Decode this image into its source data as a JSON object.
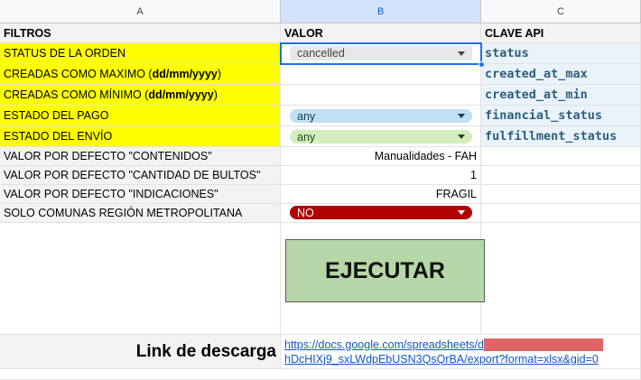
{
  "columns": [
    "A",
    "B",
    "C"
  ],
  "headers": {
    "a": "FILTROS",
    "b": "VALOR",
    "c": "CLAVE API"
  },
  "rows": [
    {
      "label": "STATUS DE LA ORDEN",
      "value": "cancelled",
      "api": "status"
    },
    {
      "label_pre": "CREADAS COMO MAXIMO (",
      "label_bold": "dd/mm/yyyy",
      "label_post": ")",
      "value": "",
      "api": "created_at_max"
    },
    {
      "label_pre": "CREADAS COMO MÍNIMO (",
      "label_bold": "dd/mm/yyyy",
      "label_post": ")",
      "value": "",
      "api": "created_at_min"
    },
    {
      "label": "ESTADO DEL PAGO",
      "value": "any",
      "api": "financial_status"
    },
    {
      "label": "ESTADO DEL ENVÍO",
      "value": "any",
      "api": "fulfillment_status"
    },
    {
      "label": "VALOR POR DEFECTO \"CONTENIDOS\"",
      "value": "Manualidades - FAH",
      "api": ""
    },
    {
      "label": "VALOR POR DEFECTO \"CANTIDAD DE BULTOS\"",
      "value": "1",
      "api": ""
    },
    {
      "label": "VALOR POR DEFECTO \"INDICACIONES\"",
      "value": "FRAGIL",
      "api": ""
    },
    {
      "label": "SOLO COMUNAS REGIÓN METROPOLITANA",
      "value": "NO",
      "api": ""
    }
  ],
  "execute_label": "EJECUTAR",
  "download": {
    "label": "Link de descarga",
    "link_line1": "https://docs.google.com/spreadsheets/d",
    "link_line2": "hDcHIXj9_sxLWdpEbUSN3QsQrBA/export?format=xlsx&gid=0"
  },
  "colors": {
    "yellow": "#ffff00",
    "execute_bg": "#b6d7a8",
    "dropdown_red": "#b10202",
    "dropdown_blue": "#bee1f4",
    "dropdown_green": "#d4edbc"
  }
}
